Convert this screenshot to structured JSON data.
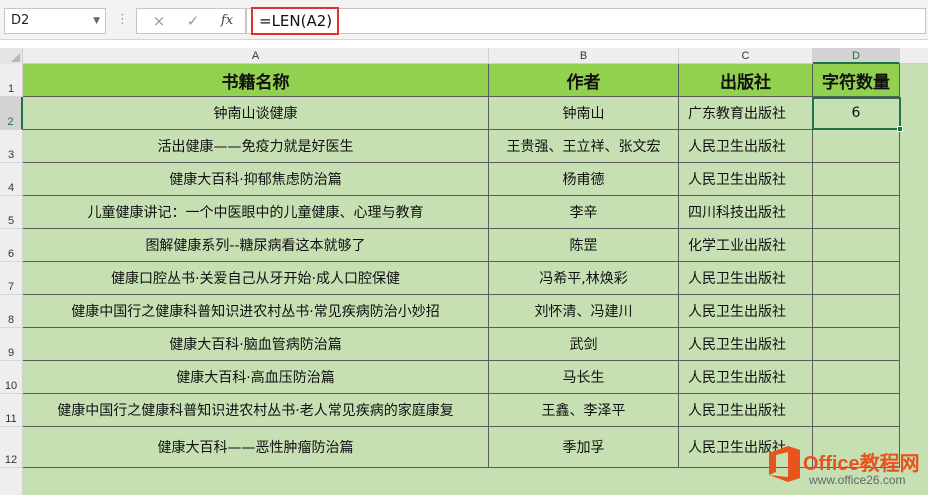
{
  "formula_bar": {
    "name_box": "D2",
    "cancel_icon": "×",
    "enter_icon": "✓",
    "fx_label": "fx",
    "formula": "=LEN(A2)"
  },
  "columns": [
    "A",
    "B",
    "C",
    "D"
  ],
  "rows": [
    "1",
    "2",
    "3",
    "4",
    "5",
    "6",
    "7",
    "8",
    "9",
    "10",
    "11",
    "12"
  ],
  "header": {
    "title": "书籍名称",
    "author": "作者",
    "publisher": "出版社",
    "char_count": "字符数量"
  },
  "books": [
    {
      "title": "钟南山谈健康",
      "author": "钟南山",
      "publisher": "广东教育出版社",
      "count": "6"
    },
    {
      "title": "活出健康——免疫力就是好医生",
      "author": "王贵强、王立祥、张文宏",
      "publisher": "人民卫生出版社",
      "count": ""
    },
    {
      "title": "健康大百科·抑郁焦虑防治篇",
      "author": "杨甫德",
      "publisher": "人民卫生出版社",
      "count": ""
    },
    {
      "title": "儿童健康讲记：一个中医眼中的儿童健康、心理与教育",
      "author": "李辛",
      "publisher": "四川科技出版社",
      "count": ""
    },
    {
      "title": "图解健康系列--糖尿病看这本就够了",
      "author": "陈罡",
      "publisher": "化学工业出版社",
      "count": ""
    },
    {
      "title": "健康口腔丛书·关爱自己从牙开始·成人口腔保健",
      "author": "冯希平,林焕彩",
      "publisher": "人民卫生出版社",
      "count": ""
    },
    {
      "title": "健康中国行之健康科普知识进农村丛书·常见疾病防治小妙招",
      "author": "刘怀清、冯建川",
      "publisher": "人民卫生出版社",
      "count": ""
    },
    {
      "title": "健康大百科·脑血管病防治篇",
      "author": "武剑",
      "publisher": "人民卫生出版社",
      "count": ""
    },
    {
      "title": "健康大百科·高血压防治篇",
      "author": "马长生",
      "publisher": "人民卫生出版社",
      "count": ""
    },
    {
      "title": "健康中国行之健康科普知识进农村丛书·老人常见疾病的家庭康复",
      "author": "王鑫、李泽平",
      "publisher": "人民卫生出版社",
      "count": ""
    },
    {
      "title": "健康大百科——恶性肿瘤防治篇",
      "author": "季加孚",
      "publisher": "人民卫生出版社",
      "count": ""
    }
  ],
  "watermark": {
    "title": "Office教程网",
    "url": "www.office26.com"
  },
  "colors": {
    "header_fill": "#92d050",
    "body_fill": "#c6e0b4",
    "selection": "#217346",
    "formula_highlight": "#e03030",
    "watermark": "#e8531e"
  }
}
